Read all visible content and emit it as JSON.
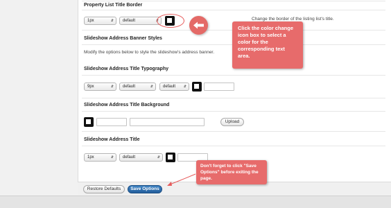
{
  "property_list": {
    "heading": "Property List Title Border",
    "size_value": "1px",
    "style_value": "default",
    "description": "Change the border of the listing list's title."
  },
  "banner": {
    "heading": "Slideshow Address Banner Styles",
    "description": "Modify the options below to style the slideshow's address banner."
  },
  "typography": {
    "heading": "Slideshow Address Title Typography",
    "size_value": "9px",
    "weight_value": "default",
    "style_value": "default",
    "color_value": ""
  },
  "background": {
    "heading": "Slideshow Address Title Background",
    "color_value": "",
    "image_value": "",
    "upload_label": "Upload"
  },
  "address_title": {
    "heading": "Slideshow Address Title",
    "size_value": "1px",
    "style_value": "default",
    "color_value": ""
  },
  "footer": {
    "restore_label": "Restore Defaults",
    "save_label": "Save Options"
  },
  "callouts": {
    "color_tip": "Click the color change icon box to select a color for the corresponding text area.",
    "save_tip": "Don't forget to click \"Save Options\" before exiting the page."
  },
  "colors": {
    "callout": "#e76b6b",
    "primary_button": "#2f6fae"
  }
}
